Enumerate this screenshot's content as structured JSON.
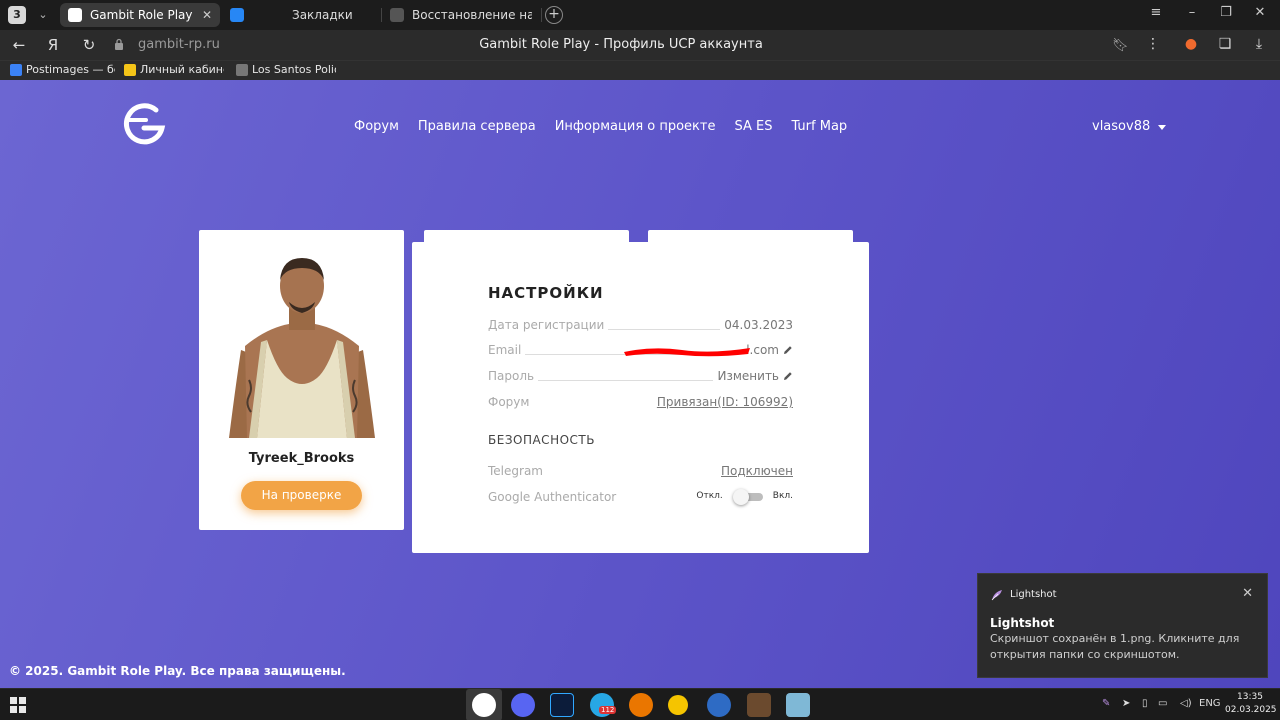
{
  "browser": {
    "tab_count": "3",
    "tabs": [
      {
        "label": "Gambit Role Play - Проф",
        "active": true
      },
      {
        "label": "Закладки",
        "active": false
      },
      {
        "label": "Восстановление на служ",
        "active": false
      }
    ],
    "url_domain": "gambit-rp.ru",
    "page_title": "Gambit Role Play - Профиль UCP аккаунта",
    "bookmarks": [
      {
        "label": "Postimages — бес"
      },
      {
        "label": "Личный кабинет"
      },
      {
        "label": "Los Santos Police"
      }
    ]
  },
  "site": {
    "nav": [
      "Форум",
      "Правила сервера",
      "Информация о проекте",
      "SA ES",
      "Turf Map"
    ],
    "username": "vlasov88",
    "footer": "© 2025. Gambit Role Play. Все права защищены."
  },
  "profile": {
    "nickname": "Tyreek_Brooks",
    "status_button": "На проверке"
  },
  "settings": {
    "title": "НАСТРОЙКИ",
    "rows": [
      {
        "label": "Дата регистрации",
        "value": "04.03.2023"
      },
      {
        "label": "Email",
        "value": "l.com"
      },
      {
        "label": "Пароль",
        "value": "Изменить"
      },
      {
        "label": "Форум",
        "value": "Привязан(ID: 106992)"
      }
    ],
    "security_title": "БЕЗОПАСНОСТЬ",
    "security_rows": [
      {
        "label": "Telegram",
        "value": "Подключен"
      },
      {
        "label": "Google Authenticator",
        "off_label": "Откл.",
        "on_label": "Вкл.",
        "enabled": false
      }
    ]
  },
  "notification": {
    "app": "Lightshot",
    "title": "Lightshot",
    "text": "Скриншот сохранён в 1.png. Кликните для открытия папки со скриншотом."
  },
  "taskbar": {
    "telegram_badge": "112",
    "language": "ENG",
    "time": "13:35",
    "date": "02.03.2025"
  },
  "colors": {
    "page_bg": "#5d55c9",
    "status_button": "#f2a446",
    "redaction": "#ff0000"
  }
}
